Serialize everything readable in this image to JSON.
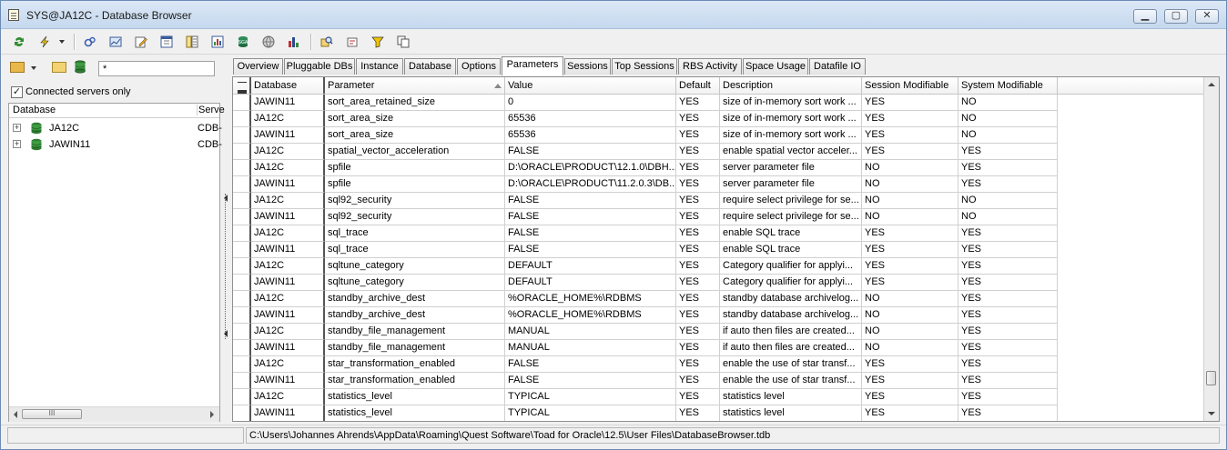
{
  "window": {
    "title": "SYS@JA12C - Database Browser",
    "minimize": "▁",
    "maximize": "▢",
    "close": "✕"
  },
  "toolbar": {
    "icons": [
      "refresh-icon",
      "lightning-icon",
      "dropdown-arrow-icon",
      "connect-icon",
      "chart-icon",
      "edit-icon",
      "window-icon",
      "list-icon",
      "report-icon",
      "sga-icon",
      "globe-icon",
      "stats-icon",
      "search-icon",
      "schema-icon",
      "filter-icon",
      "copy-icon"
    ]
  },
  "left_panel": {
    "filter_value": "*",
    "connected_only_label": "Connected servers only",
    "connected_only_checked": true,
    "tree_header": {
      "database": "Database",
      "server": "Serve"
    },
    "tree_items": [
      {
        "name": "JA12C",
        "server": "CDB-"
      },
      {
        "name": "JAWIN11",
        "server": "CDB-"
      }
    ],
    "hscroll_thumb": "III"
  },
  "tabs": [
    {
      "label": "Overview"
    },
    {
      "label": "Pluggable DBs"
    },
    {
      "label": "Instance"
    },
    {
      "label": "Database"
    },
    {
      "label": "Options"
    },
    {
      "label": "Parameters",
      "active": true
    },
    {
      "label": "Sessions"
    },
    {
      "label": "Top Sessions"
    },
    {
      "label": "RBS Activity"
    },
    {
      "label": "Space Usage"
    },
    {
      "label": "Datafile IO"
    }
  ],
  "grid": {
    "columns": [
      "Database",
      "Parameter",
      "Value",
      "Default",
      "Description",
      "Session Modifiable",
      "System Modifiable"
    ],
    "rows": [
      [
        "JAWIN11",
        "sort_area_retained_size",
        "0",
        "YES",
        "size of in-memory sort work ...",
        "YES",
        "NO"
      ],
      [
        "JA12C",
        "sort_area_size",
        "65536",
        "YES",
        "size of in-memory sort work ...",
        "YES",
        "NO"
      ],
      [
        "JAWIN11",
        "sort_area_size",
        "65536",
        "YES",
        "size of in-memory sort work ...",
        "YES",
        "NO"
      ],
      [
        "JA12C",
        "spatial_vector_acceleration",
        "FALSE",
        "YES",
        "enable spatial vector acceler...",
        "YES",
        "YES"
      ],
      [
        "JA12C",
        "spfile",
        "D:\\ORACLE\\PRODUCT\\12.1.0\\DBH...",
        "YES",
        "server parameter file",
        "NO",
        "YES"
      ],
      [
        "JAWIN11",
        "spfile",
        "D:\\ORACLE\\PRODUCT\\11.2.0.3\\DB...",
        "YES",
        "server parameter file",
        "NO",
        "YES"
      ],
      [
        "JA12C",
        "sql92_security",
        "FALSE",
        "YES",
        "require select privilege for se...",
        "NO",
        "NO"
      ],
      [
        "JAWIN11",
        "sql92_security",
        "FALSE",
        "YES",
        "require select privilege for se...",
        "NO",
        "NO"
      ],
      [
        "JA12C",
        "sql_trace",
        "FALSE",
        "YES",
        "enable SQL trace",
        "YES",
        "YES"
      ],
      [
        "JAWIN11",
        "sql_trace",
        "FALSE",
        "YES",
        "enable SQL trace",
        "YES",
        "YES"
      ],
      [
        "JA12C",
        "sqltune_category",
        "DEFAULT",
        "YES",
        "Category qualifier for applyi...",
        "YES",
        "YES"
      ],
      [
        "JAWIN11",
        "sqltune_category",
        "DEFAULT",
        "YES",
        "Category qualifier for applyi...",
        "YES",
        "YES"
      ],
      [
        "JA12C",
        "standby_archive_dest",
        "%ORACLE_HOME%\\RDBMS",
        "YES",
        "standby database archivelog...",
        "NO",
        "YES"
      ],
      [
        "JAWIN11",
        "standby_archive_dest",
        "%ORACLE_HOME%\\RDBMS",
        "YES",
        "standby database archivelog...",
        "NO",
        "YES"
      ],
      [
        "JA12C",
        "standby_file_management",
        "MANUAL",
        "YES",
        "if auto then files are created...",
        "NO",
        "YES"
      ],
      [
        "JAWIN11",
        "standby_file_management",
        "MANUAL",
        "YES",
        "if auto then files are created...",
        "NO",
        "YES"
      ],
      [
        "JA12C",
        "star_transformation_enabled",
        "FALSE",
        "YES",
        "enable the use of star transf...",
        "YES",
        "YES"
      ],
      [
        "JAWIN11",
        "star_transformation_enabled",
        "FALSE",
        "YES",
        "enable the use of star transf...",
        "YES",
        "YES"
      ],
      [
        "JA12C",
        "statistics_level",
        "TYPICAL",
        "YES",
        "statistics level",
        "YES",
        "YES"
      ],
      [
        "JAWIN11",
        "statistics_level",
        "TYPICAL",
        "YES",
        "statistics level",
        "YES",
        "YES"
      ]
    ]
  },
  "status": {
    "path": "C:\\Users\\Johannes Ahrends\\AppData\\Roaming\\Quest Software\\Toad for Oracle\\12.5\\User Files\\DatabaseBrowser.tdb"
  },
  "colors": {
    "db_icon": "#2f7d32",
    "accent": "#c5d8ee"
  }
}
